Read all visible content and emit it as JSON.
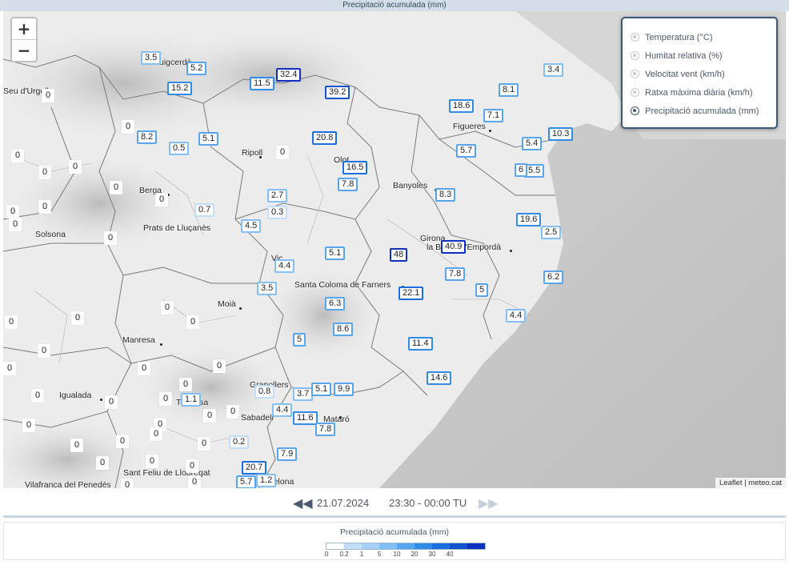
{
  "title": "Precipitació acumulada (mm)",
  "zoom": {
    "in": "+",
    "out": "−"
  },
  "layers": [
    {
      "label": "Temperatura (°C)",
      "selected": false
    },
    {
      "label": "Humitat relativa (%)",
      "selected": false
    },
    {
      "label": "Velocitat vent (km/h)",
      "selected": false
    },
    {
      "label": "Ratxa màxima diària (km/h)",
      "selected": false
    },
    {
      "label": "Precipitació acumulada (mm)",
      "selected": true
    }
  ],
  "places": [
    "Seu d'Urgell",
    "Puigcerdà",
    "Ripoll",
    "Olot",
    "Figueres",
    "Banyoles",
    "Berga",
    "Prats de Lluçanès",
    "Solsona",
    "Girona",
    "la Bisbal d'Empordà",
    "Vic",
    "Santa Coloma de Farners",
    "Moià",
    "Manresa",
    "Igualada",
    "Terrassa",
    "Sabadell",
    "Granollers",
    "Mataró",
    "Sant Feliu de Llobregat",
    "Barcelona",
    "Vilafranca del Penedès"
  ],
  "stations": [
    "3.5",
    "5.2",
    "15.2",
    "11.5",
    "32.4",
    "39.2",
    "0",
    "8.2",
    "0.5",
    "5.1",
    "0",
    "20.8",
    "16.5",
    "7.8",
    "2.7",
    "0.3",
    "4.5",
    "0.7",
    "0",
    "0",
    "0",
    "0",
    "0",
    "0",
    "0",
    "0",
    "0",
    "18.6",
    "7.1",
    "8.1",
    "3.4",
    "10.3",
    "5.4",
    "5.5",
    "6",
    "5.7",
    "8.3",
    "19.6",
    "2.5",
    "40.9",
    "48",
    "5.1",
    "4.4",
    "7.8",
    "6.2",
    "5",
    "22.1",
    "3.5",
    "6.3",
    "0",
    "0",
    "0",
    "0",
    "8.6",
    "5",
    "0",
    "11.4",
    "4.4",
    "14.6",
    "0",
    "0",
    "0",
    "0",
    "0",
    "0",
    "0",
    "0",
    "0",
    "0",
    "0",
    "0.8",
    "3.7",
    "5.1",
    "9.9",
    "1.1",
    "4.4",
    "11.6",
    "7.8",
    "0",
    "0",
    "0.2",
    "0",
    "0",
    "0",
    "7.9",
    "0",
    "20.7",
    "5.7",
    "1.2",
    "0",
    "0",
    "0",
    "0"
  ],
  "station_colors": {
    "0": "#ffffff",
    "0.2": "#c2ddf7",
    "1": "#82bff4",
    "5": "#56a5ee",
    "10": "#318ce8",
    "20": "#1a6fe0",
    "30": "#1353cf",
    "40": "#0e2fc0"
  },
  "attribution": "Leaflet | meteo.cat",
  "time": {
    "date": "21.07.2024",
    "range": "23:30 - 00:00 TU"
  },
  "legend": {
    "title": "Precipitació acumulada (mm)",
    "ticks": [
      "0",
      "0.2",
      "1",
      "5",
      "10",
      "20",
      "30",
      "40"
    ],
    "colors": [
      "#ffffff",
      "#c2ddf7",
      "#a6d0f6",
      "#82bff4",
      "#56a5ee",
      "#318ce8",
      "#1a6fe0",
      "#1353cf",
      "#0e2fc0"
    ]
  }
}
